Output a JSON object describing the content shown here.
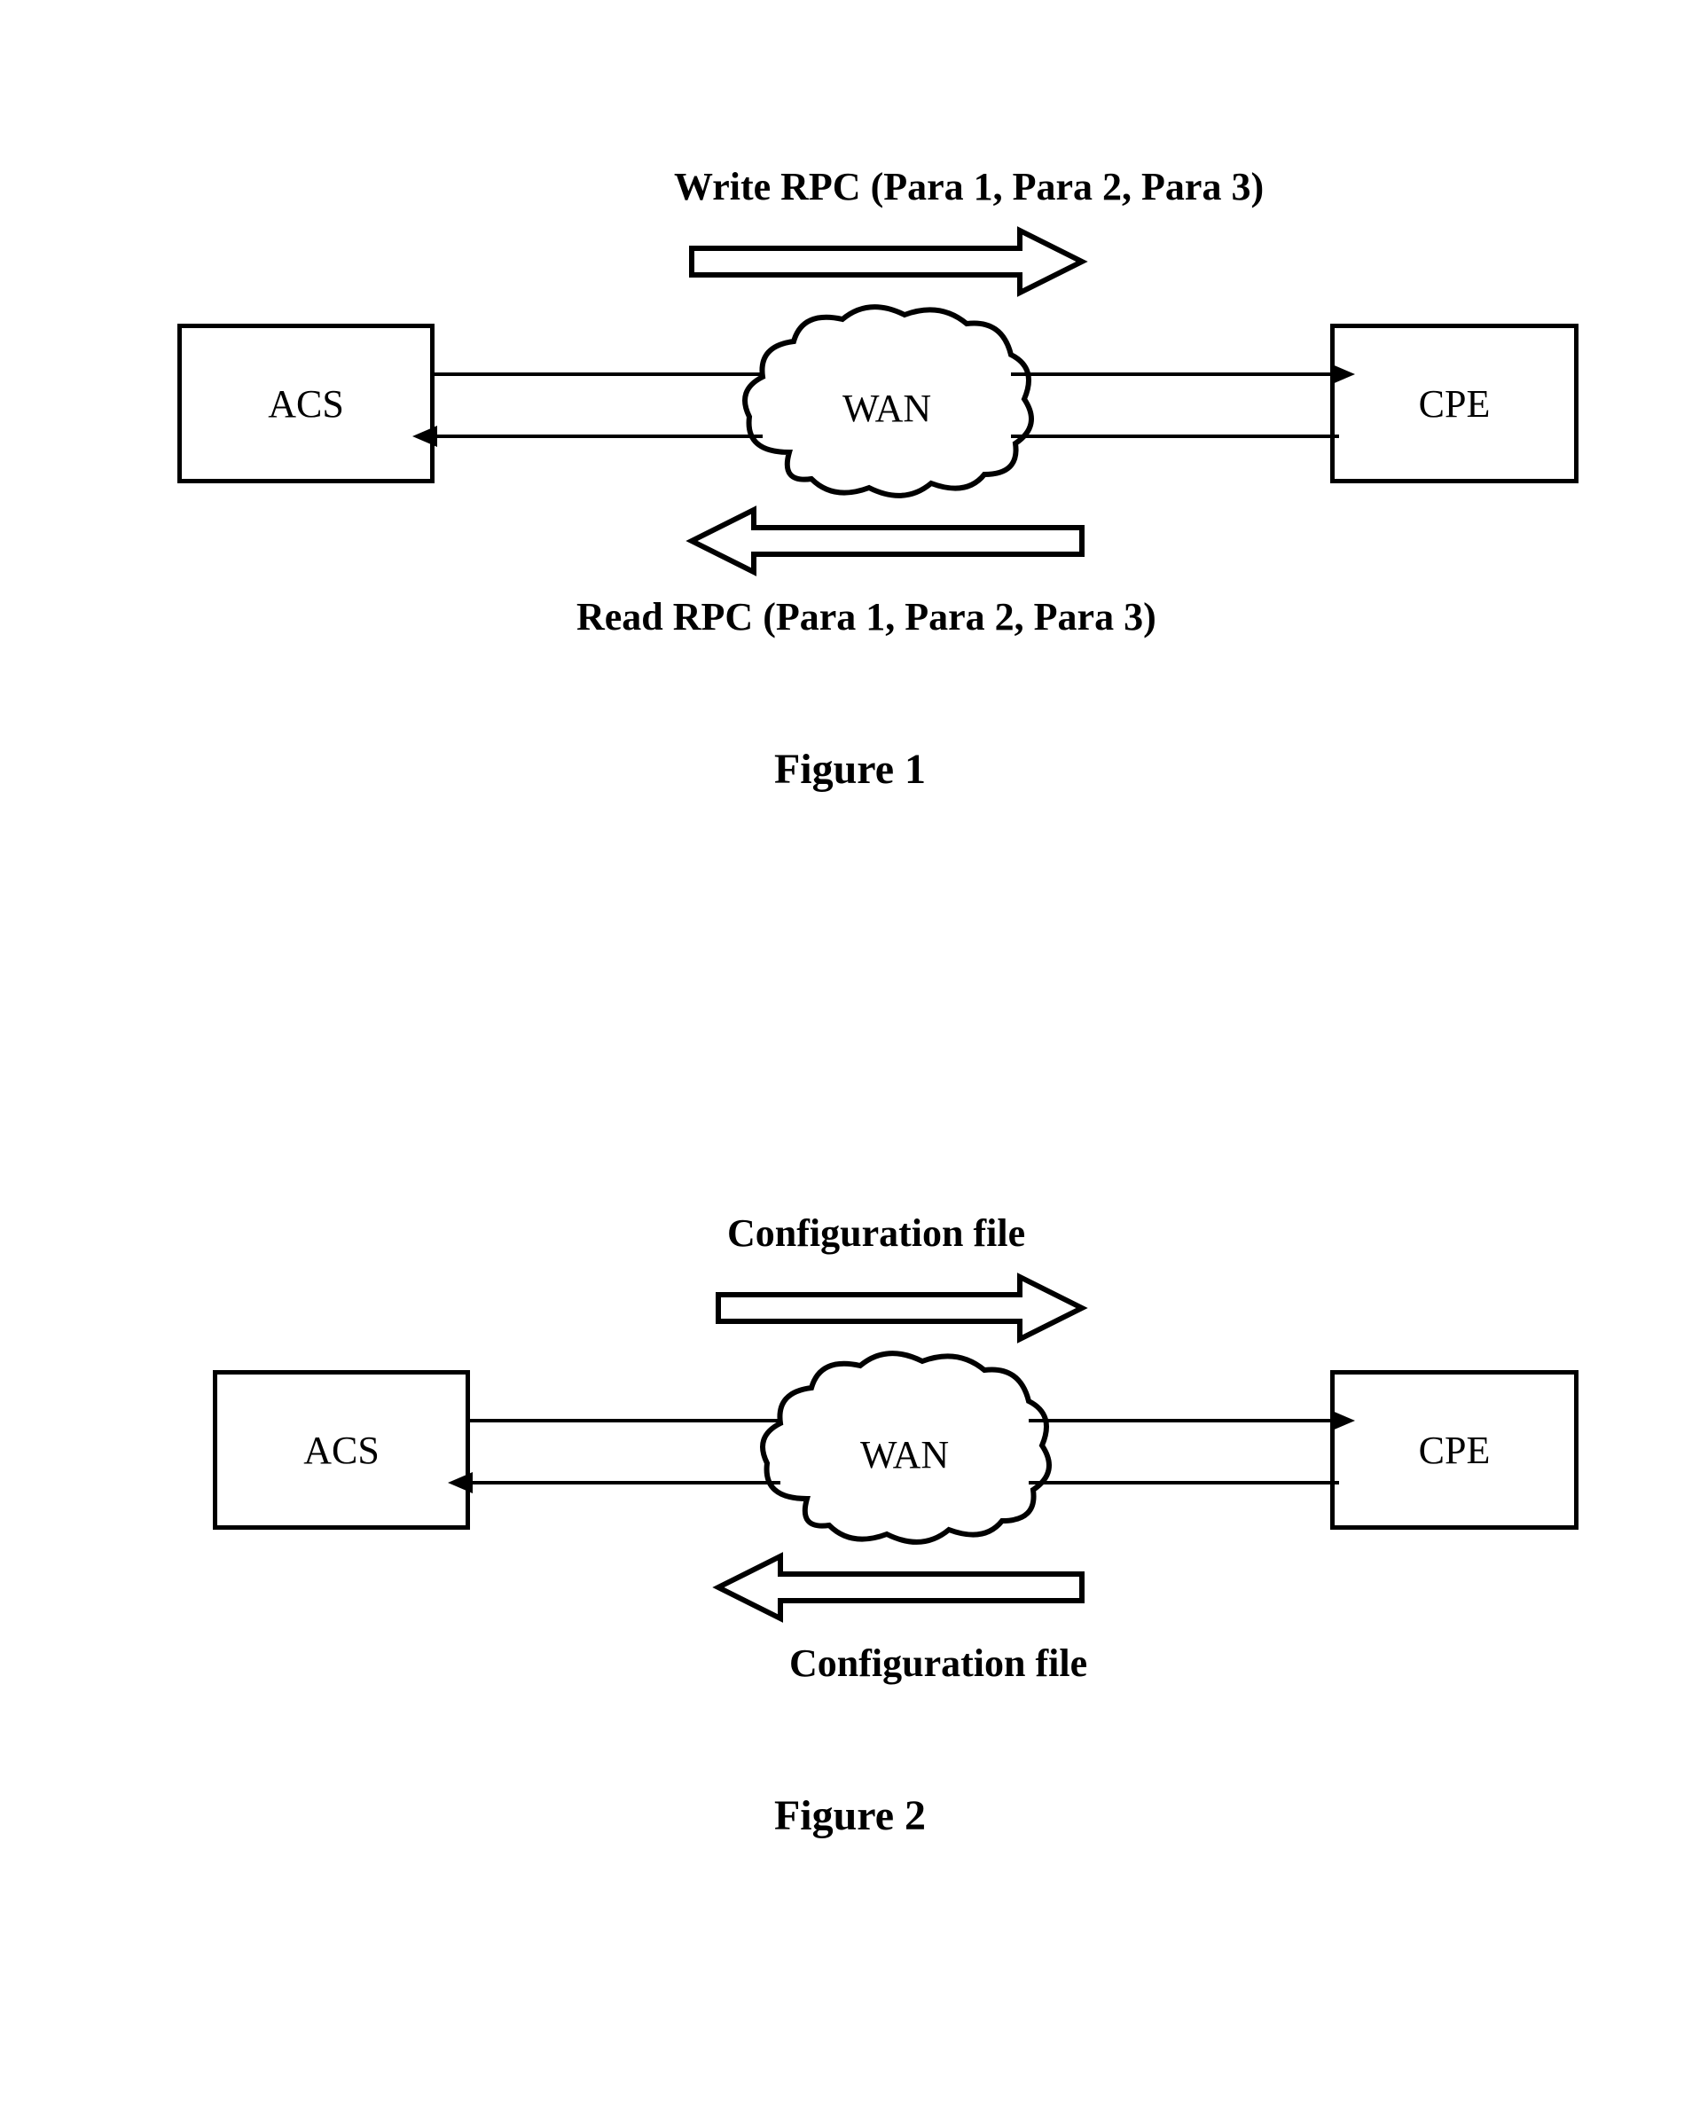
{
  "figure1": {
    "acs_label": "ACS",
    "wan_label": "WAN",
    "cpe_label": "CPE",
    "top_arrow_label": "Write RPC (Para 1, Para 2, Para 3)",
    "bottom_arrow_label": "Read RPC (Para 1, Para 2, Para 3)",
    "caption": "Figure 1"
  },
  "figure2": {
    "acs_label": "ACS",
    "wan_label": "WAN",
    "cpe_label": "CPE",
    "top_arrow_label": "Configuration file",
    "bottom_arrow_label": "Configuration file",
    "caption": "Figure 2"
  }
}
